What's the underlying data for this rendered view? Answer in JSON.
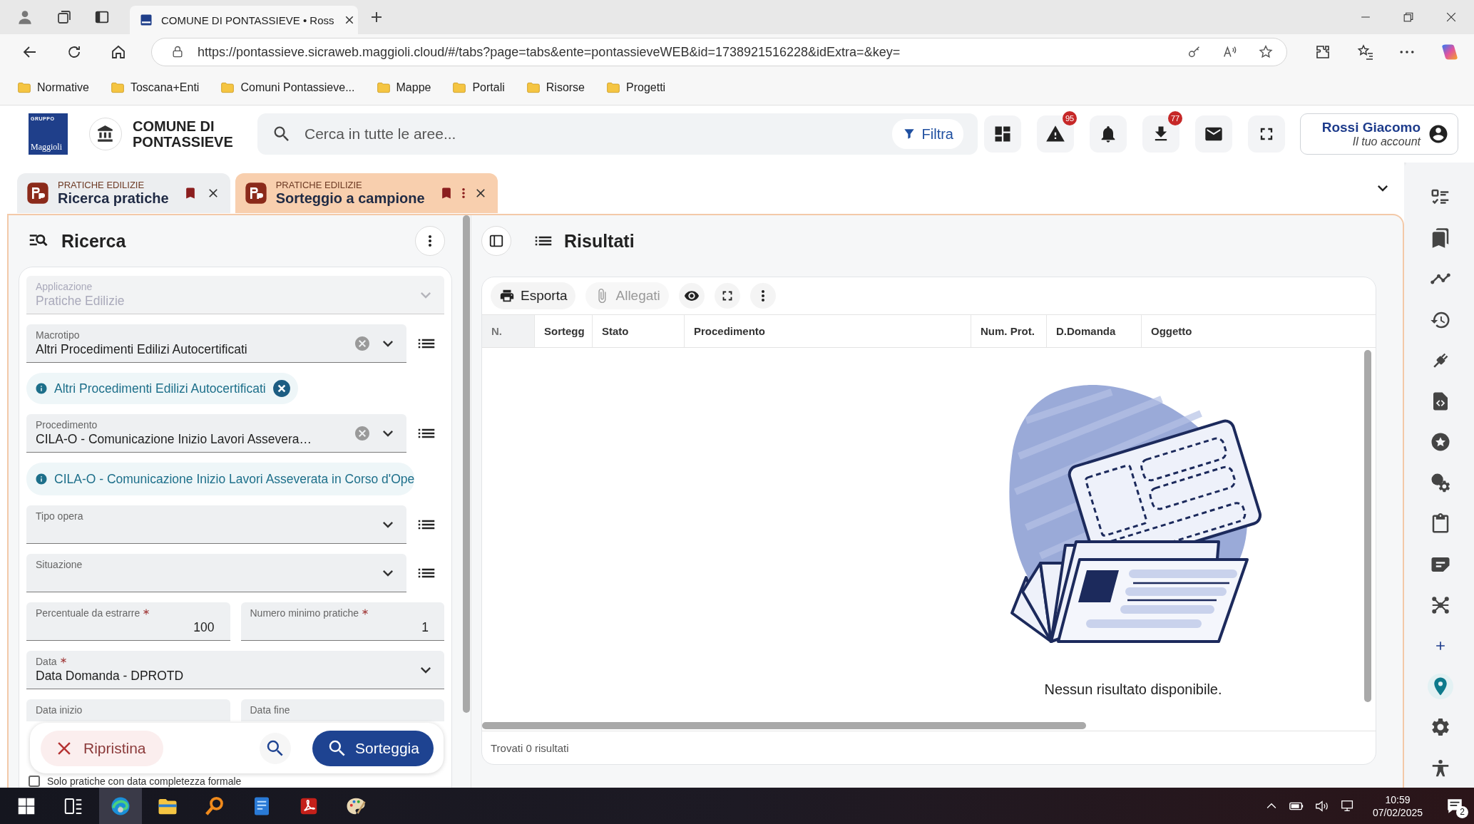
{
  "browser": {
    "tab": {
      "title": "COMUNE DI PONTASSIEVE • Ross",
      "selected": true
    },
    "url": "https://pontassieve.sicraweb.maggioli.cloud/#/tabs?page=tabs&ente=pontassieveWEB&id=1738921516228&idExtra=&key=",
    "bookmarks": [
      "Normative",
      "Toscana+Enti",
      "Comuni Pontassieve...",
      "Mappe",
      "Portali",
      "Risorse",
      "Progetti"
    ]
  },
  "header": {
    "logo_small": "GRUPPO",
    "logo_name": "Maggioli",
    "org_name": "COMUNE DI PONTASSIEVE",
    "search_placeholder": "Cerca in tutte le aree...",
    "filter_label": "Filtra",
    "actions": [
      {
        "kind": "dashboard"
      },
      {
        "kind": "alert",
        "badge": "95"
      },
      {
        "kind": "bell"
      },
      {
        "kind": "download",
        "badge": "77"
      },
      {
        "kind": "mail"
      },
      {
        "kind": "fullscreen"
      }
    ],
    "user": {
      "name": "Rossi Giacomo",
      "subtitle": "Il tuo account"
    }
  },
  "app_tabs": [
    {
      "category": "PRATICHE EDILIZIE",
      "title": "Ricerca pratiche",
      "selected": false
    },
    {
      "category": "PRATICHE EDILIZIE",
      "title": "Sorteggio a campione",
      "selected": true
    }
  ],
  "search_panel": {
    "title": "Ricerca",
    "fields": [
      {
        "kind": "select",
        "label": "Applicazione",
        "value": "Pratiche Edilizie",
        "disabled": true,
        "required": false,
        "clearable": false,
        "list_button": false
      },
      {
        "kind": "select",
        "label": "Macrotipo",
        "value": "Altri Procedimenti Edilizi Autocertificati",
        "disabled": false,
        "required": false,
        "clearable": true,
        "list_button": true
      },
      {
        "kind": "chip",
        "text": "Altri Procedimenti Edilizi Autocertificati",
        "removable": true
      },
      {
        "kind": "select",
        "label": "Procedimento",
        "value": "CILA-O - Comunicazione Inizio Lavori Assevera…",
        "disabled": false,
        "required": false,
        "clearable": true,
        "list_button": true
      },
      {
        "kind": "chip",
        "text": "CILA-O - Comunicazione Inizio Lavori Asseverata in Corso d'Ope",
        "removable": false
      },
      {
        "kind": "select",
        "label": "Tipo opera",
        "disabled": false,
        "required": false,
        "clearable": false,
        "list_button": true
      },
      {
        "kind": "select",
        "label": "Situazione",
        "disabled": false,
        "required": false,
        "clearable": false,
        "list_button": true
      },
      {
        "kind": "pair",
        "items": [
          {
            "label": "Percentuale da estrarre",
            "value": "100",
            "required": true
          },
          {
            "label": "Numero minimo pratiche",
            "value": "1",
            "required": true
          }
        ]
      },
      {
        "kind": "select",
        "label": "Data",
        "value": "Data Domanda - DPROTD",
        "disabled": false,
        "required": true,
        "clearable": false,
        "list_button": false
      },
      {
        "kind": "pair",
        "items": [
          {
            "label": "Data inizio",
            "required": false
          },
          {
            "label": "Data fine",
            "required": false
          }
        ]
      }
    ],
    "reset_label": "Ripristina",
    "submit_label": "Sorteggia",
    "checkbox": {
      "label": "Solo pratiche con data completezza formale",
      "checked": false
    }
  },
  "results": {
    "title": "Risultati",
    "toolbar": [
      {
        "kind": "export",
        "label": "Esporta",
        "disabled": false
      },
      {
        "kind": "attachments",
        "label": "Allegati",
        "disabled": true
      },
      {
        "kind": "preview"
      },
      {
        "kind": "fullscreen"
      },
      {
        "kind": "more"
      }
    ],
    "columns": [
      "N.",
      "Sortegg",
      "Stato",
      "Procedimento",
      "Num. Prot.",
      "D.Domanda",
      "Oggetto"
    ],
    "empty_message": "Nessun risultato disponibile.",
    "footer": "Trovati 0 risultati"
  },
  "right_sidebar": [
    {
      "kind": "checklist",
      "selected": false
    },
    {
      "kind": "bookmarks",
      "selected": false
    },
    {
      "kind": "trend",
      "selected": false
    },
    {
      "kind": "history",
      "selected": false
    },
    {
      "kind": "plug",
      "selected": false
    },
    {
      "kind": "code_file",
      "selected": false
    },
    {
      "kind": "star",
      "selected": false
    },
    {
      "kind": "coin_gear",
      "selected": false
    },
    {
      "kind": "clipboard",
      "selected": false
    },
    {
      "kind": "note",
      "selected": false
    },
    {
      "kind": "network",
      "selected": false
    },
    {
      "kind": "plus",
      "selected": false
    },
    {
      "kind": "pin",
      "selected": true
    },
    {
      "kind": "settings",
      "selected": false
    },
    {
      "kind": "accessibility",
      "selected": false
    }
  ],
  "taskbar": {
    "apps": [
      {
        "kind": "start",
        "selected": false
      },
      {
        "kind": "taskview",
        "selected": false
      },
      {
        "kind": "browser",
        "selected": true
      },
      {
        "kind": "folder",
        "selected": false
      },
      {
        "kind": "magnifier",
        "selected": false
      },
      {
        "kind": "document",
        "selected": false
      },
      {
        "kind": "pdf",
        "selected": false
      },
      {
        "kind": "palette",
        "selected": false
      }
    ],
    "time": "10:59",
    "date": "07/02/2025",
    "notifications": "2"
  }
}
